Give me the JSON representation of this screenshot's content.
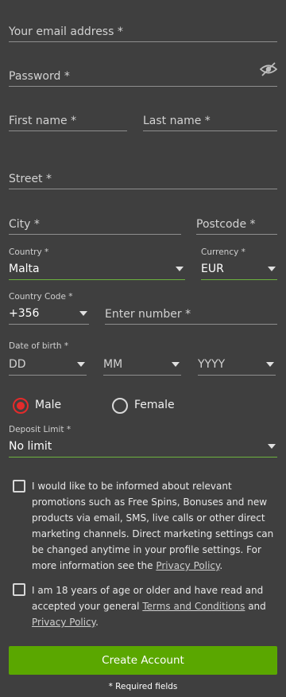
{
  "form": {
    "email_placeholder": "Your email address *",
    "password_placeholder": "Password *",
    "first_name_placeholder": "First name *",
    "last_name_placeholder": "Last name *",
    "street_placeholder": "Street *",
    "city_placeholder": "City *",
    "postcode_placeholder": "Postcode *",
    "country": {
      "label": "Country *",
      "value": "Malta"
    },
    "currency": {
      "label": "Currency *",
      "value": "EUR"
    },
    "country_code": {
      "label": "Country Code *",
      "value": "+356"
    },
    "phone_placeholder": "Enter number *",
    "dob": {
      "label": "Date of birth *",
      "day": "DD",
      "month": "MM",
      "year": "YYYY"
    },
    "gender": {
      "male": "Male",
      "female": "Female",
      "selected": "Male"
    },
    "deposit_limit": {
      "label": "Deposit Limit *",
      "value": "No limit"
    },
    "promotions": {
      "text": "I would like to be informed about relevant promotions such as Free Spins, Bonuses and new products via email, SMS, live calls or other direct marketing channels. Direct marketing settings can be changed anytime in your profile settings. For more information see the",
      "link": "Privacy Policy",
      "end": "."
    },
    "terms": {
      "text": "I am 18 years of age or older and have read and accepted your general",
      "terms_link": "Terms and Conditions",
      "and": "and",
      "privacy_link": "Privacy Policy",
      "end": "."
    },
    "submit_label": "Create Account",
    "required_note": "* Required fields"
  },
  "icons": {
    "password_toggle": "eye-slash-icon"
  },
  "colors": {
    "background": "#3f3f3f",
    "accent_green": "#5aa700",
    "valid_underline": "#6db33f",
    "radio_selected": "#e32b2b"
  }
}
